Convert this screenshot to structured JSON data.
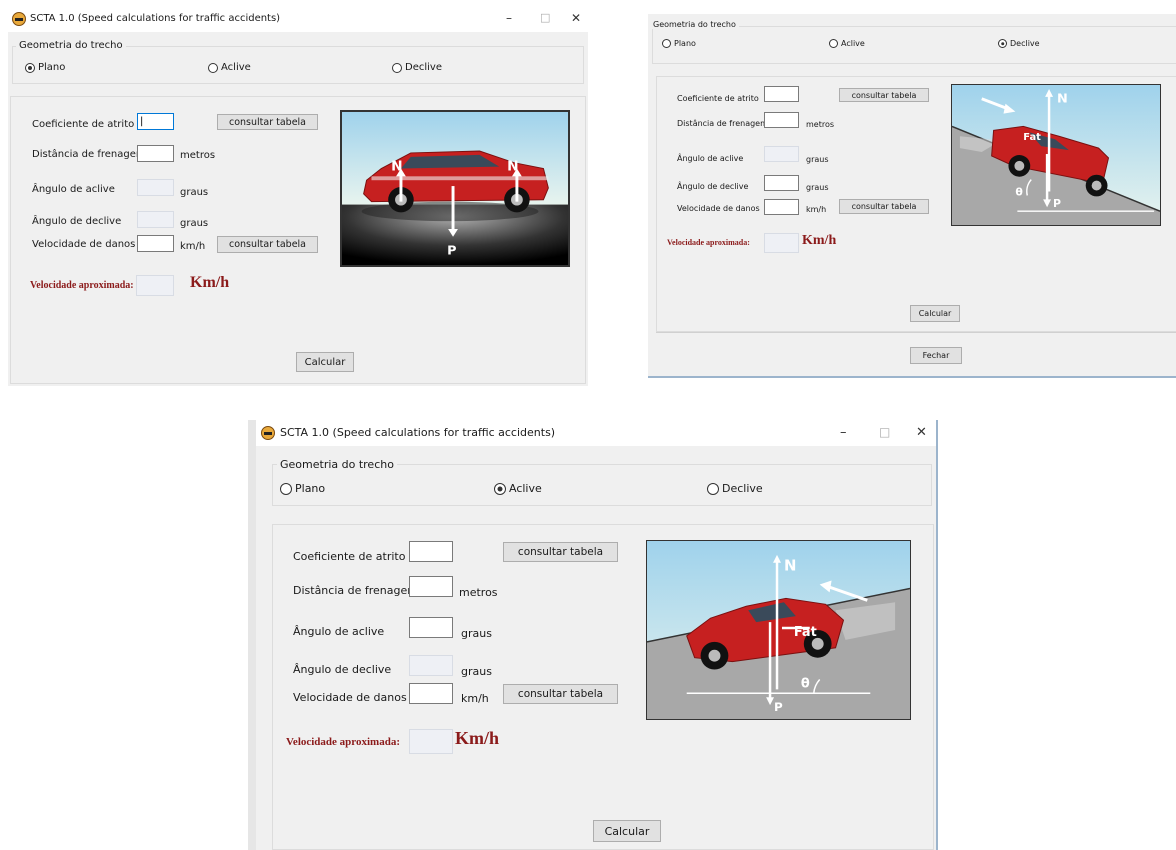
{
  "title": "SCTA 1.0 (Speed calculations for traffic accidents)",
  "controls": {
    "minimize": "–",
    "maximize": "□",
    "close": "✕"
  },
  "geometry_group": {
    "label": "Geometria do trecho",
    "options": [
      "Plano",
      "Aclive",
      "Declive"
    ]
  },
  "fields": {
    "coef": "Coeficiente de atrito",
    "dist": "Distância de frenagem",
    "aclive": "Ângulo de aclive",
    "declive": "Ângulo de declive",
    "veloc": "Velocidade de danos"
  },
  "units": {
    "metros": "metros",
    "graus": "graus",
    "kmh": "km/h",
    "kmh_big": "Km/h"
  },
  "buttons": {
    "consultar": "consultar tabela",
    "calcular": "Calcular",
    "fechar": "Fechar"
  },
  "result_label": "Velocidade aproximada:",
  "force_labels": {
    "n": "N",
    "p": "P",
    "fat": "Fat",
    "theta": "θ"
  },
  "icons": {
    "app": "car-app-icon",
    "radio": "radio-circle"
  },
  "selected": {
    "window_plano": "Plano",
    "window_declive": "Declive",
    "window_aclive": "Aclive"
  },
  "colors": {
    "car": "#c62020",
    "accent_title": "#8b1a1a",
    "focus": "#0078d7"
  }
}
